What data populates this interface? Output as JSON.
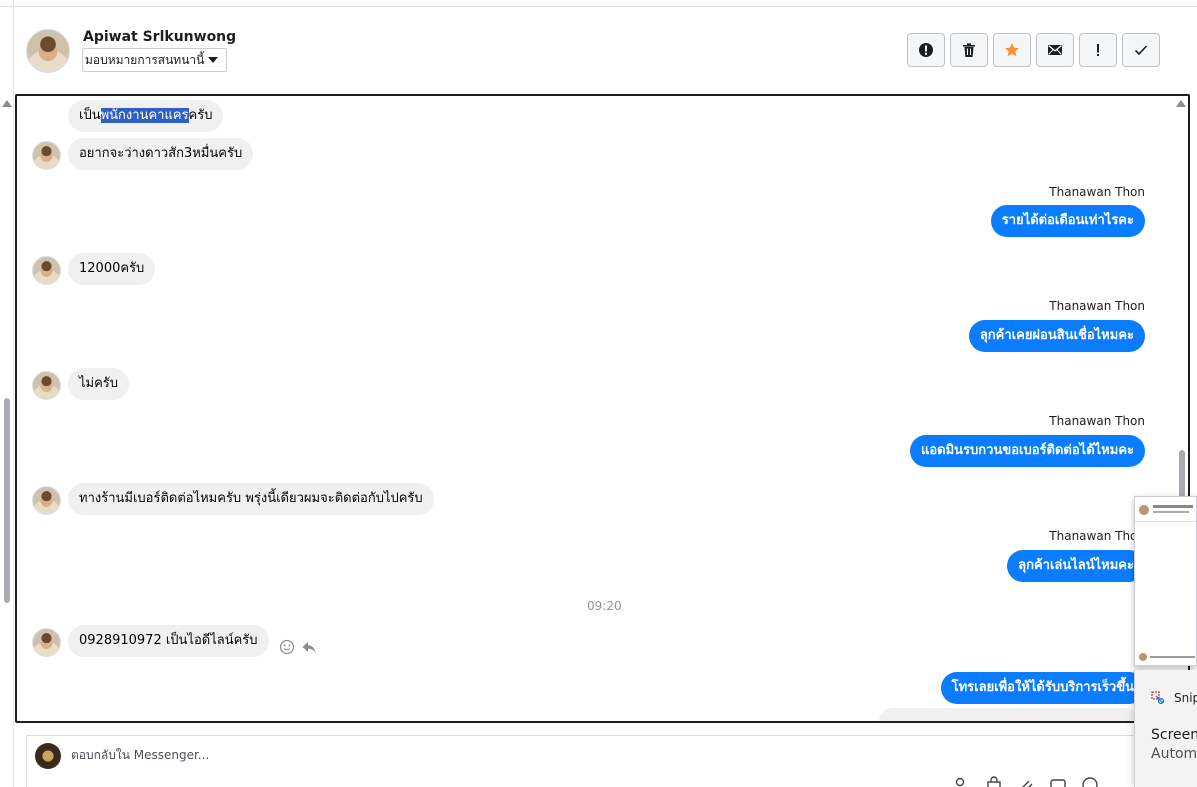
{
  "header": {
    "name": "Apiwat Srlkunwong",
    "assign_label": "มอบหมายการสนทนานี้"
  },
  "conversation": {
    "incoming": [
      {
        "pre": "เป็น",
        "highlight": "พนักงานคาแคร",
        "post": "ครับ"
      },
      {
        "text": "อยากจะว่างดาวสัก3หมื่นครับ"
      },
      {
        "text": "12000ครับ"
      },
      {
        "text": "ไม่ครับ"
      },
      {
        "text": "ทางร้านมีเบอร์ติดต่อไหมครับ พรุ่งนี้เดียวผมจะติดต่อกับไปครับ"
      },
      {
        "text": "0928910972 เป็นไอดีไลน์ครับ"
      }
    ],
    "outgoing": [
      {
        "sender": "Thanawan Thon",
        "text": "รายได้ต่อเดือนเท่าไรคะ"
      },
      {
        "sender": "Thanawan Thon",
        "text": "ลุกค้าเคยผ่อนสินเชื่อไหมคะ"
      },
      {
        "sender": "Thanawan Thon",
        "text": "แอดมินรบกวนขอเบอร์ติดต่อได้ไหมคะ"
      },
      {
        "sender": "Thanawan Thon",
        "text": "ลุกค้าเล่นไลน์ไหมคะ"
      },
      {
        "text": "โทรเลยเพื่อให้ได้รับบริการเร็วขึ้น"
      }
    ],
    "timestamp": "09:20"
  },
  "reply": {
    "placeholder": "ตอบกลับใน Messenger..."
  },
  "toast": {
    "app": "Snip",
    "title": "Screens",
    "body": "Automa"
  },
  "colors": {
    "outgoing_bubble": "#0a7cff",
    "incoming_bubble": "#f0f0f0",
    "star": "#f7923a",
    "highlight": "#2f5fc4"
  }
}
